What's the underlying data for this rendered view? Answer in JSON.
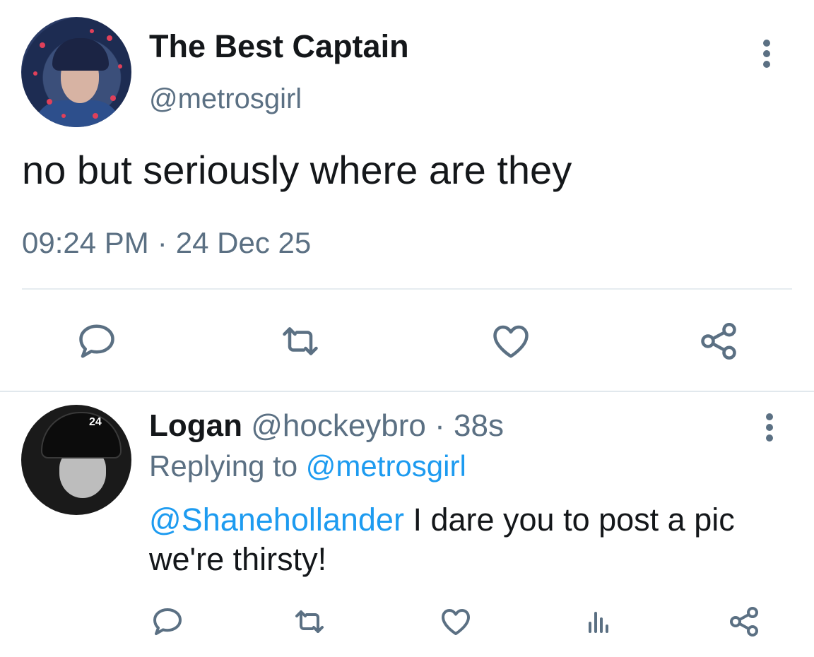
{
  "main_tweet": {
    "display_name": "The Best Captain",
    "handle": "@metrosgirl",
    "text": "no but seriously where are they",
    "time": "09:24 PM",
    "separator": "·",
    "date": "24 Dec 25"
  },
  "reply": {
    "display_name": "Logan",
    "handle": "@hockeybro",
    "separator": "·",
    "age": "38s",
    "replying_prefix": "Replying to",
    "replying_handle": "@metrosgirl",
    "mention": "@Shanehollander",
    "text": " I dare you to post a pic we're thirsty!",
    "avatar_jersey_number": "24"
  },
  "icons": {
    "actions_main": [
      "reply-icon",
      "retweet-icon",
      "like-icon",
      "share-icon"
    ],
    "actions_reply": [
      "reply-icon",
      "retweet-icon",
      "like-icon",
      "analytics-icon",
      "share-icon"
    ],
    "more": "more-vertical-icon"
  },
  "colors": {
    "text": "#14171a",
    "secondary": "#5b7083",
    "link": "#1d9bf0",
    "divider": "#e6ecf0"
  }
}
